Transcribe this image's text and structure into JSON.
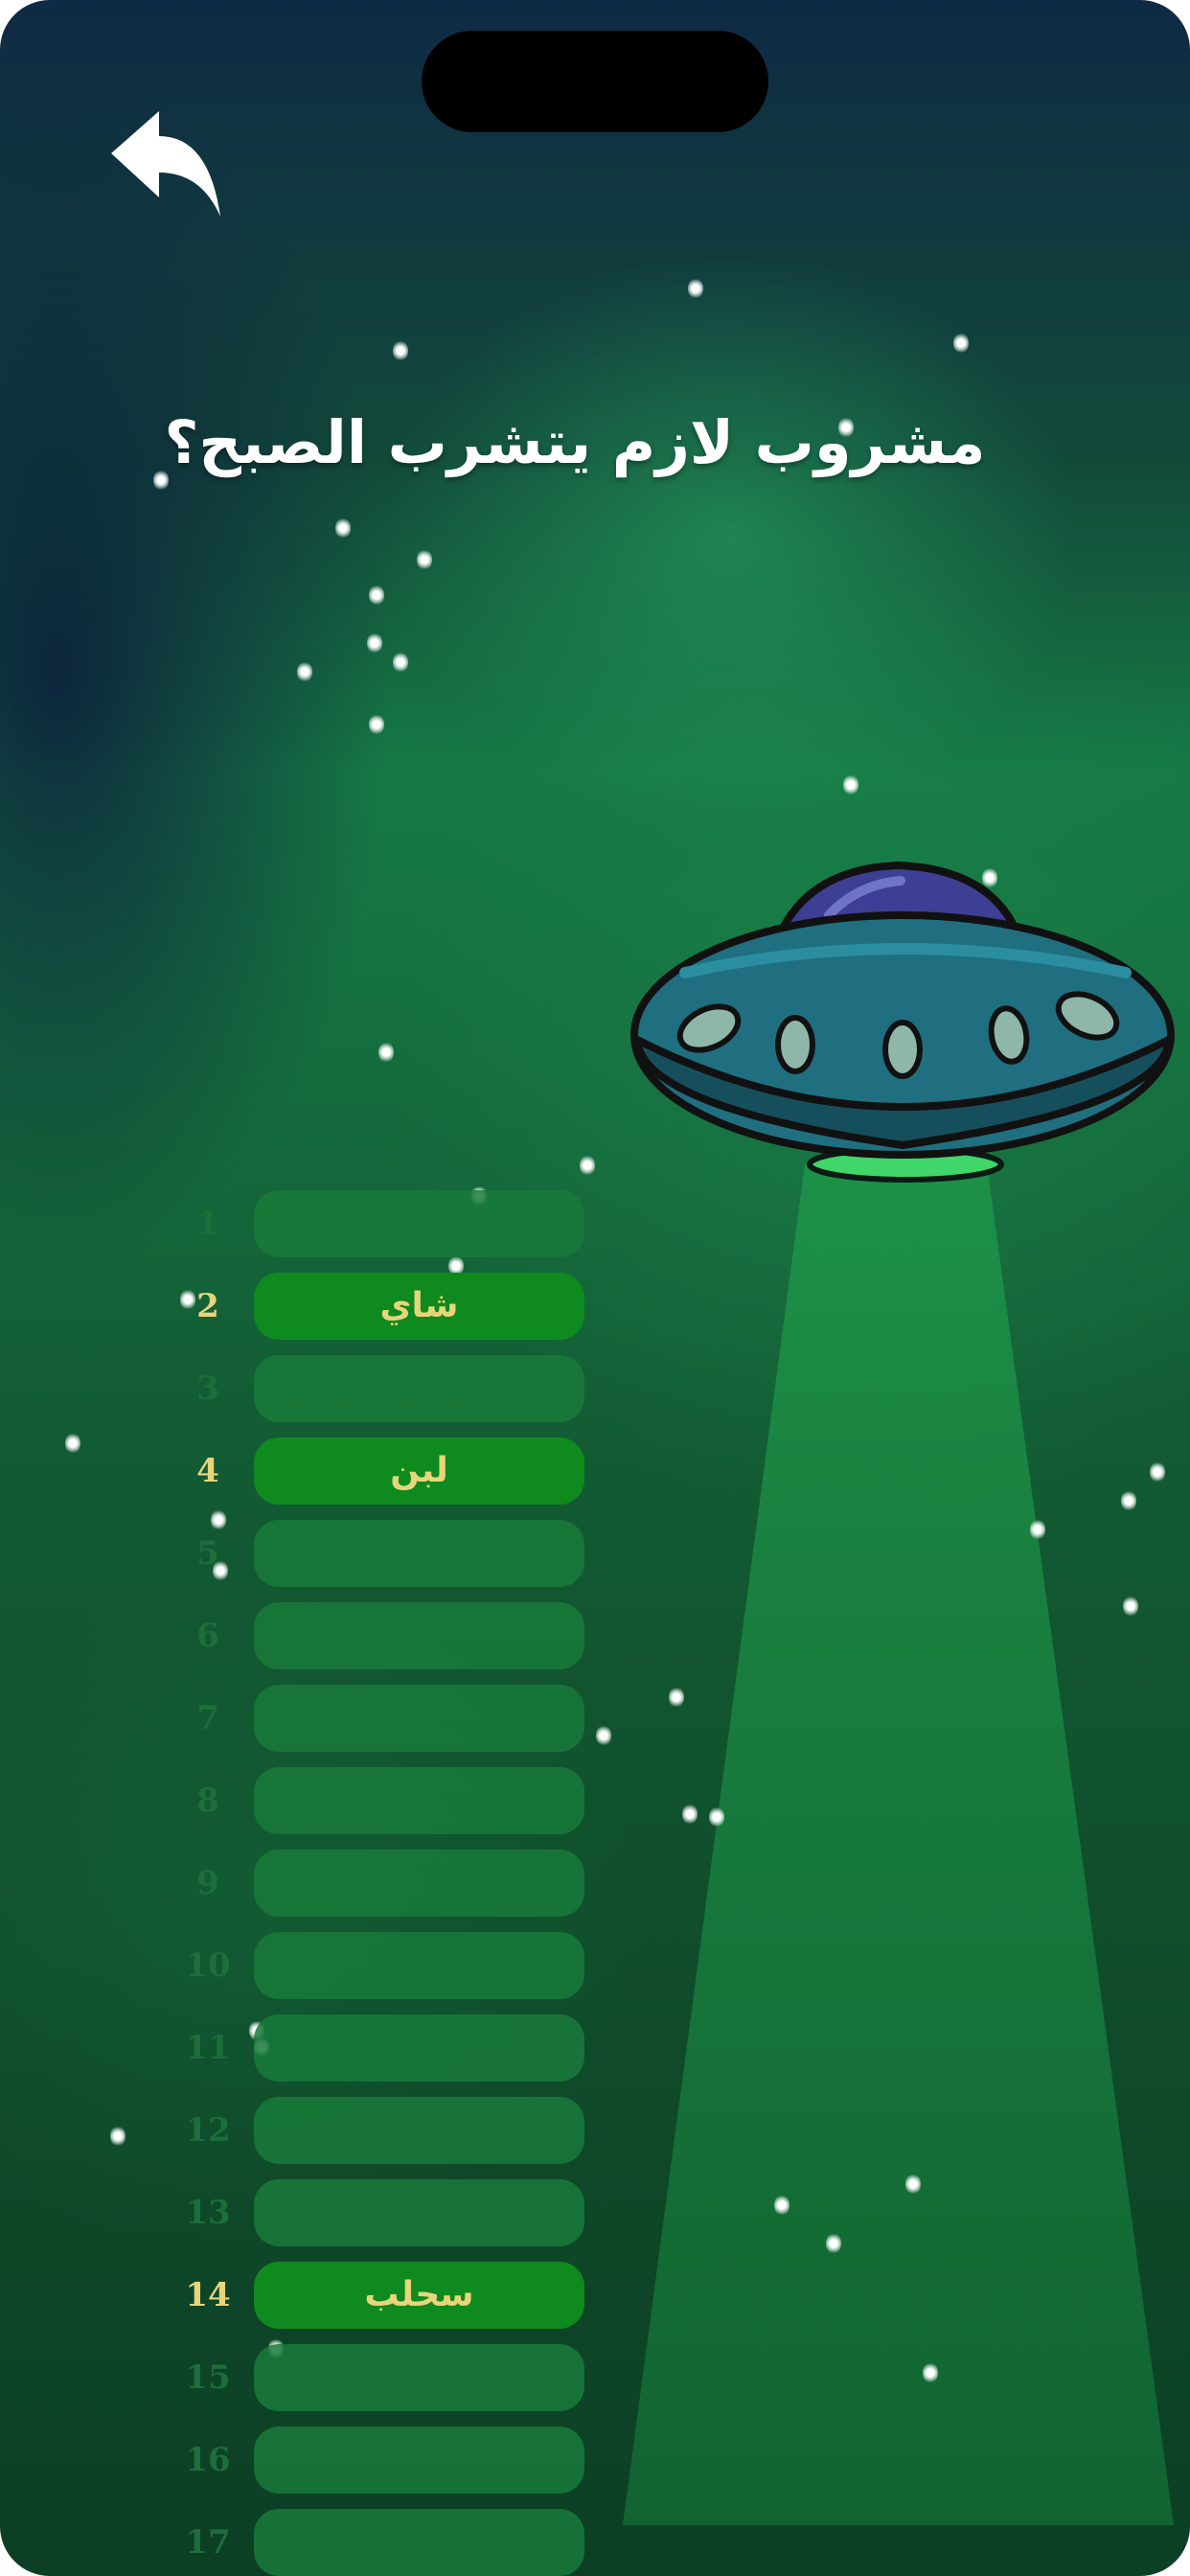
{
  "question": "مشروب لازم يتشرب الصبح؟",
  "back_icon": "back-arrow-icon",
  "ufo_icon": "ufo-icon",
  "colors": {
    "revealed_slot": "#0e8a1e",
    "hidden_slot": "#197a3a",
    "answer_text": "#e8d57a",
    "question_text": "#ffffff"
  },
  "answers": [
    {
      "number": "1",
      "text": ""
    },
    {
      "number": "2",
      "text": "شاي"
    },
    {
      "number": "3",
      "text": ""
    },
    {
      "number": "4",
      "text": "لبن"
    },
    {
      "number": "5",
      "text": ""
    },
    {
      "number": "6",
      "text": ""
    },
    {
      "number": "7",
      "text": ""
    },
    {
      "number": "8",
      "text": ""
    },
    {
      "number": "9",
      "text": ""
    },
    {
      "number": "10",
      "text": ""
    },
    {
      "number": "11",
      "text": ""
    },
    {
      "number": "12",
      "text": ""
    },
    {
      "number": "13",
      "text": ""
    },
    {
      "number": "14",
      "text": "سحلب"
    },
    {
      "number": "15",
      "text": ""
    },
    {
      "number": "16",
      "text": ""
    },
    {
      "number": "17",
      "text": ""
    }
  ]
}
